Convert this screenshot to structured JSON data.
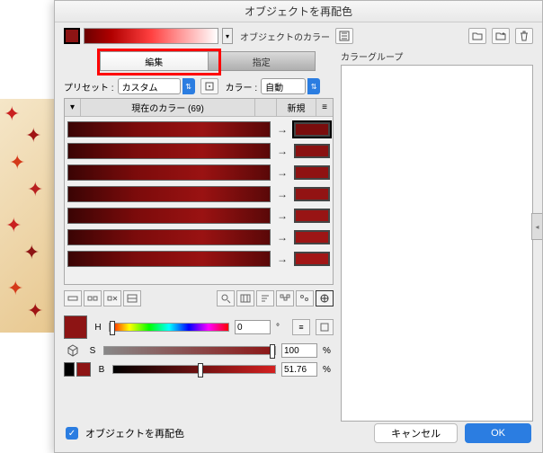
{
  "dialog": {
    "title": "オブジェクトを再配色",
    "object_color_label": "オブジェクトのカラー"
  },
  "tabs": {
    "edit": "編集",
    "assign": "指定"
  },
  "preset": {
    "label": "プリセット :",
    "value": "カスタム",
    "color_label": "カラー :",
    "color_value": "自動"
  },
  "list": {
    "header_current": "現在のカラー (69)",
    "header_new": "新規",
    "rows": [
      {
        "new_color": "#7a0d0d",
        "selected": true
      },
      {
        "new_color": "#8a1111",
        "selected": false
      },
      {
        "new_color": "#8f1212",
        "selected": false
      },
      {
        "new_color": "#921313",
        "selected": false
      },
      {
        "new_color": "#981414",
        "selected": false
      },
      {
        "new_color": "#9d1515",
        "selected": false
      },
      {
        "new_color": "#a21616",
        "selected": false
      }
    ]
  },
  "hsb": {
    "h": {
      "label": "H",
      "value": "0",
      "unit": "°",
      "pos": 0
    },
    "s": {
      "label": "S",
      "value": "100",
      "unit": "%",
      "pos": 100
    },
    "b": {
      "label": "B",
      "value": "51.76",
      "unit": "%",
      "pos": 52
    }
  },
  "colorgroup": {
    "label": "カラーグループ"
  },
  "footer": {
    "checkbox_label": "オブジェクトを再配色",
    "cancel": "キャンセル",
    "ok": "OK"
  }
}
